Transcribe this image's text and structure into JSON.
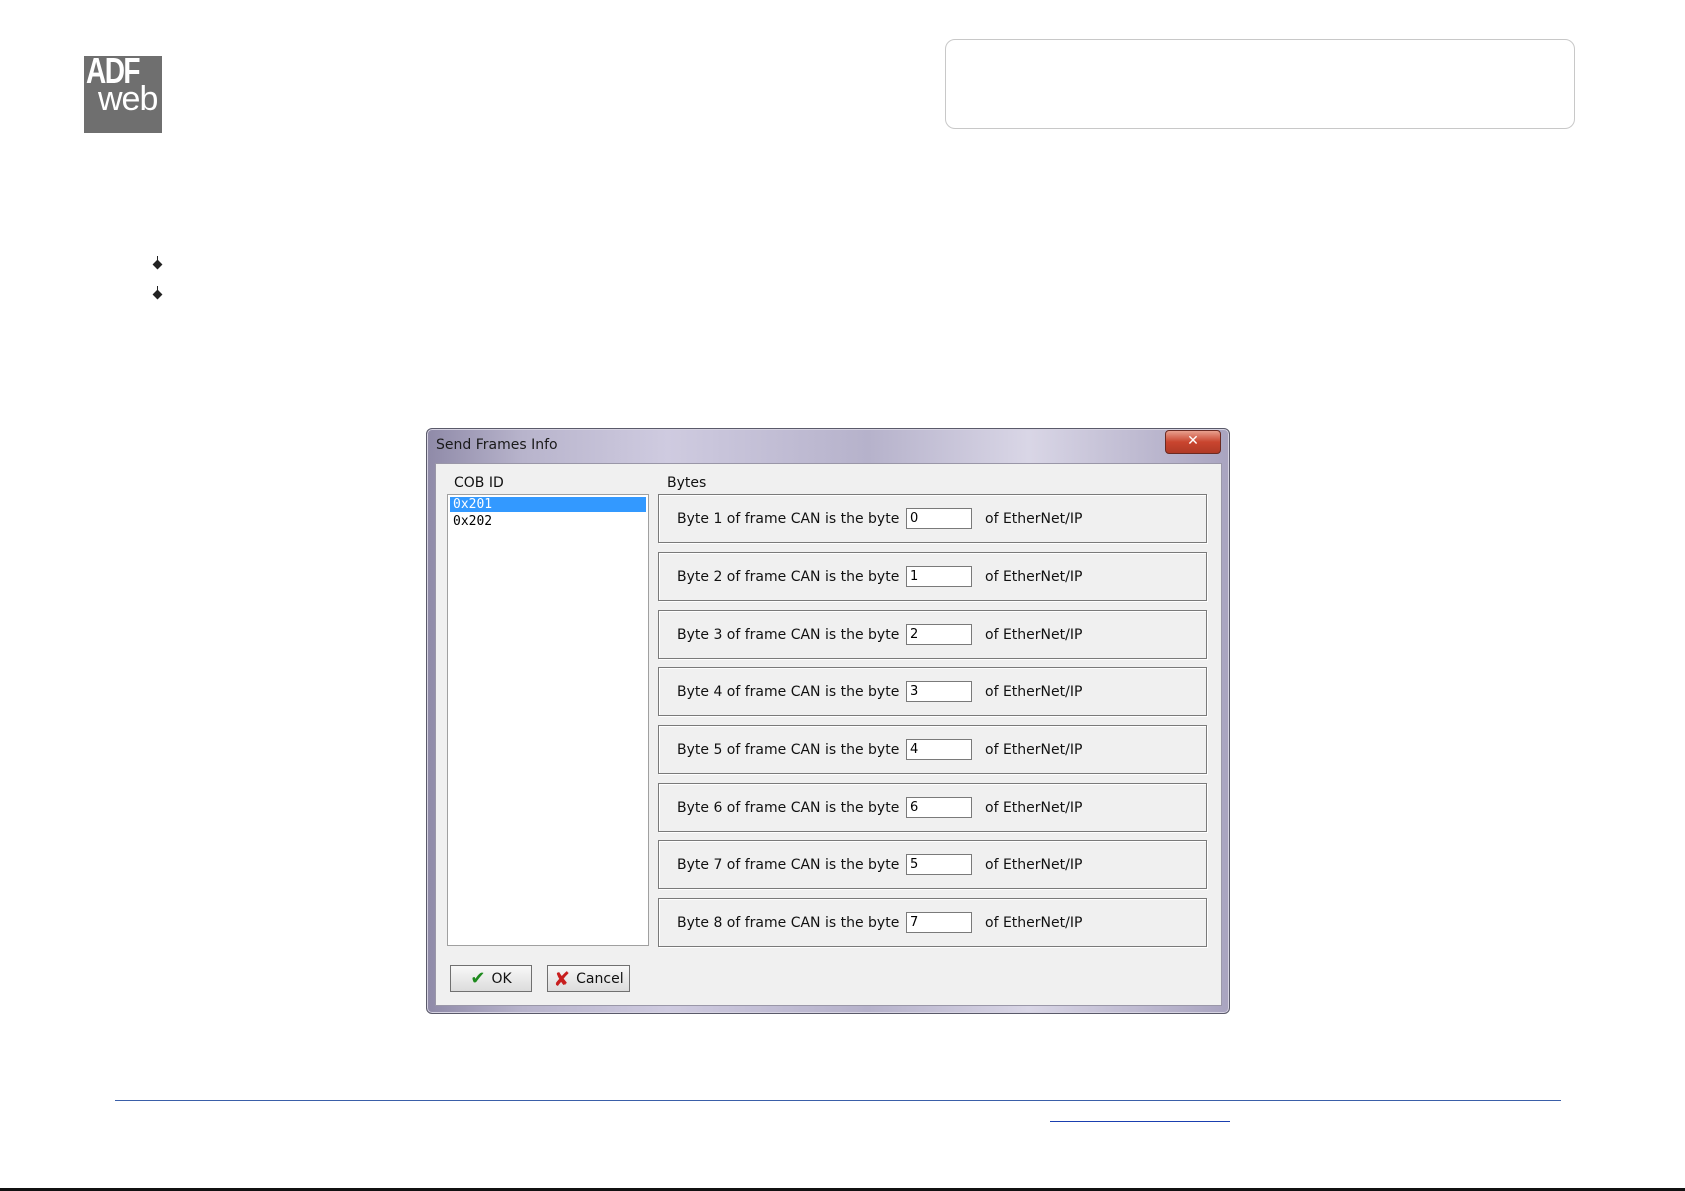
{
  "logo": {
    "line1": "ADF",
    "line2": "web"
  },
  "dialog": {
    "title": "Send Frames Info",
    "close_icon": "x",
    "cob_label": "COB ID",
    "bytes_label": "Bytes",
    "cob_ids": [
      {
        "label": "0x201",
        "selected": true
      },
      {
        "label": "0x202",
        "selected": false
      }
    ],
    "byte_rows": [
      {
        "prefix": "Byte 1 of frame CAN is the byte",
        "value": "0",
        "suffix": "of EtherNet/IP"
      },
      {
        "prefix": "Byte 2 of frame CAN is the byte",
        "value": "1",
        "suffix": "of EtherNet/IP"
      },
      {
        "prefix": "Byte 3 of frame CAN is the byte",
        "value": "2",
        "suffix": "of EtherNet/IP"
      },
      {
        "prefix": "Byte 4 of frame CAN is the byte",
        "value": "3",
        "suffix": "of EtherNet/IP"
      },
      {
        "prefix": "Byte 5 of frame CAN is the byte",
        "value": "4",
        "suffix": "of EtherNet/IP"
      },
      {
        "prefix": "Byte 6 of frame CAN is the byte",
        "value": "6",
        "suffix": "of EtherNet/IP"
      },
      {
        "prefix": "Byte 7 of frame CAN is the byte",
        "value": "5",
        "suffix": "of EtherNet/IP"
      },
      {
        "prefix": "Byte 8 of frame CAN is the byte",
        "value": "7",
        "suffix": "of EtherNet/IP"
      }
    ],
    "ok_label": "OK",
    "cancel_label": "Cancel"
  },
  "icons": {
    "ok": "check-icon",
    "cancel": "x-icon",
    "bullet": "diamond-bullet-icon"
  },
  "colors": {
    "selection": "#3399ff",
    "footer_rule": "#3a5fa8"
  }
}
